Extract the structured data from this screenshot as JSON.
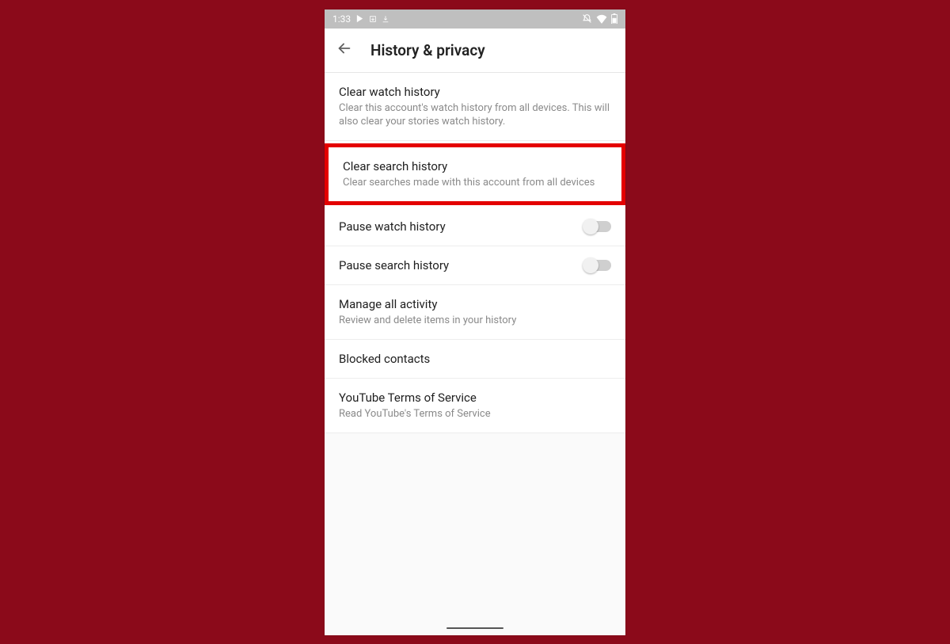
{
  "statusBar": {
    "time": "1:33"
  },
  "header": {
    "title": "History & privacy"
  },
  "items": {
    "clearWatch": {
      "title": "Clear watch history",
      "sub": "Clear this account's watch history from all devices. This will also clear your stories watch history."
    },
    "clearSearch": {
      "title": "Clear search history",
      "sub": "Clear searches made with this account from all devices"
    },
    "pauseWatch": {
      "title": "Pause watch history"
    },
    "pauseSearch": {
      "title": "Pause search history"
    },
    "manageActivity": {
      "title": "Manage all activity",
      "sub": "Review and delete items in your history"
    },
    "blockedContacts": {
      "title": "Blocked contacts"
    },
    "terms": {
      "title": "YouTube Terms of Service",
      "sub": "Read YouTube's Terms of Service"
    }
  }
}
